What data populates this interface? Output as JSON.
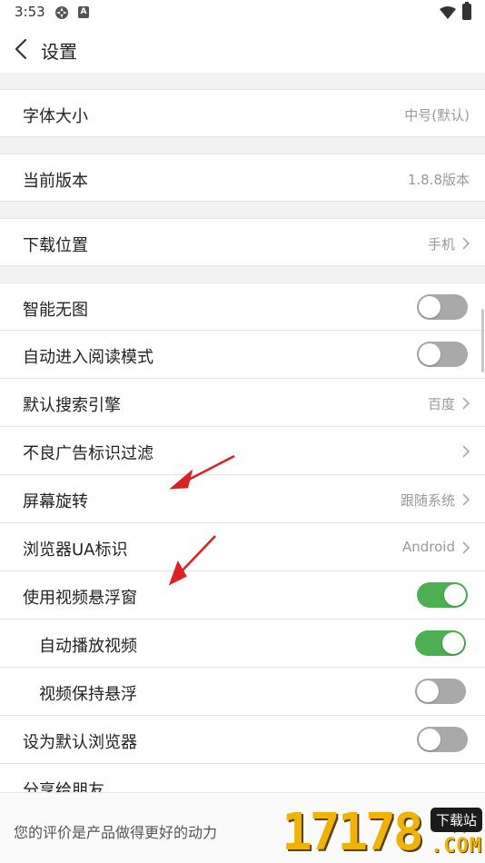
{
  "status_bar": {
    "time": "3:53",
    "icons": [
      "settings-icon",
      "a-icon",
      "wifi-icon",
      "battery-icon"
    ]
  },
  "header": {
    "title": "设置",
    "back_icon": "chevron-left-icon"
  },
  "rows": {
    "font_size": {
      "label": "字体大小",
      "value": "中号(默认)"
    },
    "version": {
      "label": "当前版本",
      "value": "1.8.8版本"
    },
    "download": {
      "label": "下载位置",
      "value": "手机"
    },
    "smart_no_image": {
      "label": "智能无图",
      "toggle": false
    },
    "auto_reader": {
      "label": "自动进入阅读模式",
      "toggle": false
    },
    "search_engine": {
      "label": "默认搜索引擎",
      "value": "百度"
    },
    "ad_filter": {
      "label": "不良广告标识过滤",
      "value": ""
    },
    "rotation": {
      "label": "屏幕旋转",
      "value": "跟随系统"
    },
    "ua": {
      "label": "浏览器UA标识",
      "value": "Android"
    },
    "float_video": {
      "label": "使用视频悬浮窗",
      "toggle": true
    },
    "autoplay": {
      "label": "自动播放视频",
      "toggle": true
    },
    "keep_float": {
      "label": "视频保持悬浮",
      "toggle": false
    },
    "default_browser": {
      "label": "设为默认浏览器",
      "toggle": false
    },
    "share": {
      "label": "分享给朋友"
    }
  },
  "bottom_bar": {
    "text": "您的评价是产品做得更好的动力",
    "close_icon": "close-icon"
  },
  "watermark": {
    "number": "17178",
    "tag": "下载站",
    "suffix": ".COM"
  },
  "colors": {
    "toggle_on": "#4caf50",
    "toggle_off": "#a9a9a9",
    "annotation_arrow": "#e02020"
  }
}
